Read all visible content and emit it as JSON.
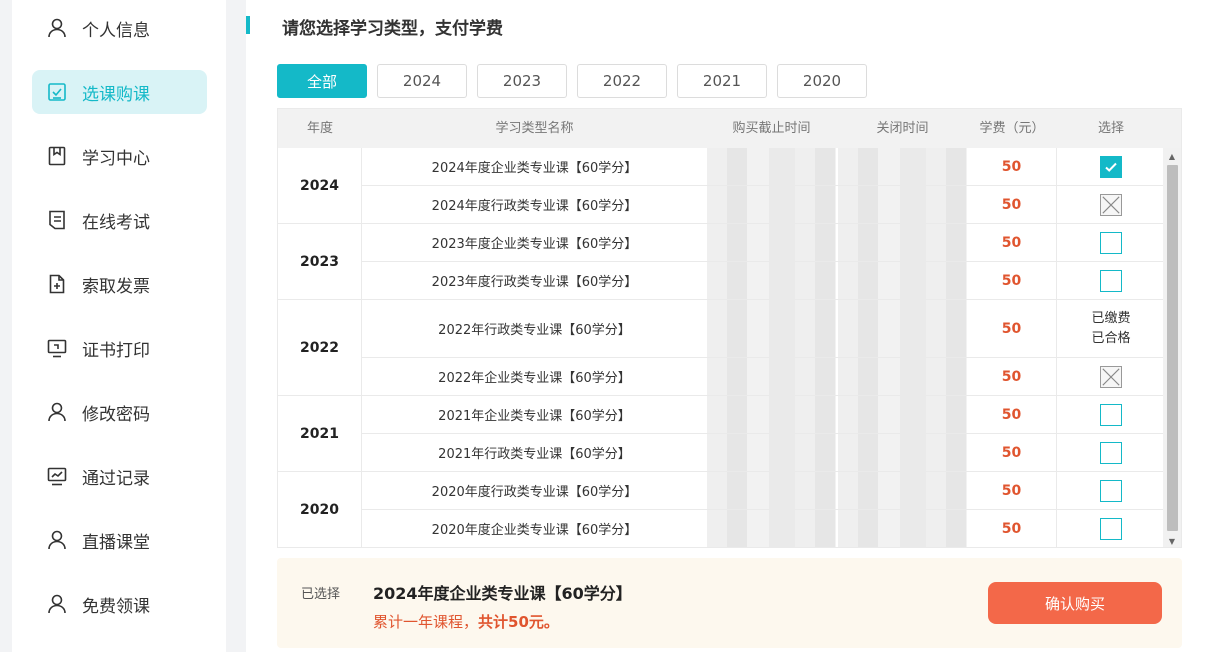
{
  "sidebar": {
    "items": [
      {
        "label": "个人信息",
        "icon": "user-icon",
        "active": false
      },
      {
        "label": "选课购课",
        "icon": "checkbox-icon",
        "active": true
      },
      {
        "label": "学习中心",
        "icon": "bookmark-icon",
        "active": false
      },
      {
        "label": "在线考试",
        "icon": "document-icon",
        "active": false
      },
      {
        "label": "索取发票",
        "icon": "file-add-icon",
        "active": false
      },
      {
        "label": "证书打印",
        "icon": "monitor-icon",
        "active": false
      },
      {
        "label": "修改密码",
        "icon": "user-icon",
        "active": false
      },
      {
        "label": "通过记录",
        "icon": "chart-icon",
        "active": false
      },
      {
        "label": "直播课堂",
        "icon": "user-icon",
        "active": false
      },
      {
        "label": "免费领课",
        "icon": "user-icon",
        "active": false
      }
    ]
  },
  "page": {
    "title": "请您选择学习类型，支付学费",
    "tabs": [
      "全部",
      "2024",
      "2023",
      "2022",
      "2021",
      "2020"
    ],
    "active_tab": "全部"
  },
  "table": {
    "headers": {
      "year": "年度",
      "name": "学习类型名称",
      "deadline": "购买截止时间",
      "close": "关闭时间",
      "fee": "学费（元）",
      "select": "选择"
    },
    "groups": [
      {
        "year": "2024",
        "rows": [
          {
            "name": "2024年度企业类专业课【60学分】",
            "fee": "50",
            "status": "checked"
          },
          {
            "name": "2024年度行政类专业课【60学分】",
            "fee": "50",
            "status": "disabled"
          }
        ]
      },
      {
        "year": "2023",
        "rows": [
          {
            "name": "2023年度企业类专业课【60学分】",
            "fee": "50",
            "status": "unchecked"
          },
          {
            "name": "2023年度行政类专业课【60学分】",
            "fee": "50",
            "status": "unchecked"
          }
        ]
      },
      {
        "year": "2022",
        "rows": [
          {
            "name": "2022年行政类专业课【60学分】",
            "fee": "50",
            "status": "text",
            "text": [
              "已缴费",
              "已合格"
            ]
          },
          {
            "name": "2022年企业类专业课【60学分】",
            "fee": "50",
            "status": "disabled"
          }
        ]
      },
      {
        "year": "2021",
        "rows": [
          {
            "name": "2021年企业类专业课【60学分】",
            "fee": "50",
            "status": "unchecked"
          },
          {
            "name": "2021年行政类专业课【60学分】",
            "fee": "50",
            "status": "unchecked"
          }
        ]
      },
      {
        "year": "2020",
        "rows": [
          {
            "name": "2020年度行政类专业课【60学分】",
            "fee": "50",
            "status": "unchecked"
          },
          {
            "name": "2020年度企业类专业课【60学分】",
            "fee": "50",
            "status": "unchecked"
          }
        ]
      }
    ]
  },
  "summary": {
    "label": "已选择",
    "course": "2024年度企业类专业课【60学分】",
    "total_prefix": "累计一年课程，",
    "total_amount": "共计50元。",
    "confirm_label": "确认购买"
  },
  "colors": {
    "accent": "#14b9c8",
    "fee": "#e0552f",
    "confirm": "#f36849"
  }
}
